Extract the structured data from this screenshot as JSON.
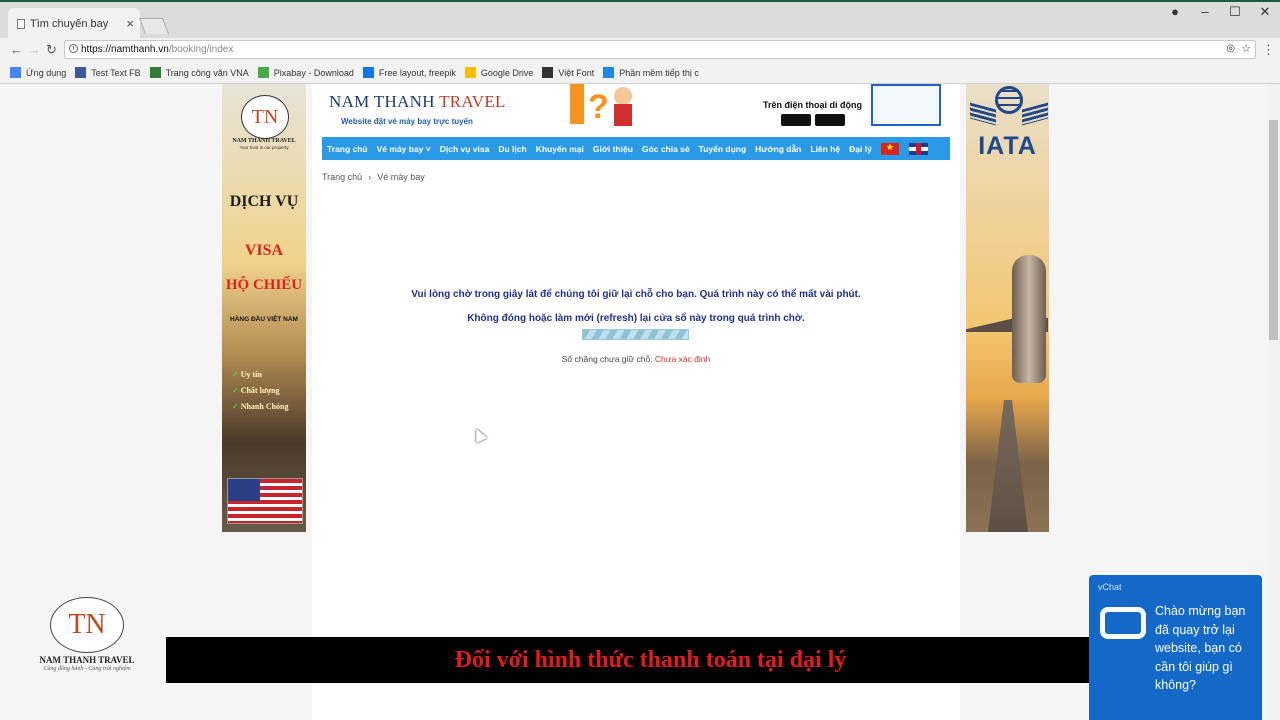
{
  "browser": {
    "tab_title": "Tìm chuyến bay",
    "url_host": "https://namthanh.vn",
    "url_path": "/booking/index",
    "bookmarks": [
      {
        "label": "Ứng dụng",
        "icon": "apps-icon",
        "color": "#4285f4"
      },
      {
        "label": "Test Text FB",
        "icon": "facebook-icon",
        "color": "#3b5998"
      },
      {
        "label": "Trang công văn VNA",
        "icon": "doc-icon",
        "color": "#2e7d32"
      },
      {
        "label": "Pixabay - Download",
        "icon": "pixabay-icon",
        "color": "#48a947"
      },
      {
        "label": "Free layout, freepik",
        "icon": "freepik-icon",
        "color": "#1273eb"
      },
      {
        "label": "Google Drive",
        "icon": "drive-icon",
        "color": "#fbbc04"
      },
      {
        "label": "Việt Font",
        "icon": "font-icon",
        "color": "#333333"
      },
      {
        "label": "Phần mềm tiếp thị c",
        "icon": "mail-icon",
        "color": "#1e88e5"
      }
    ]
  },
  "site": {
    "brand_a": "NAM THANH",
    "brand_b": "TRAVEL",
    "tagline": "Website đặt vé máy bay trực tuyến",
    "app_text": "Trên điện thoại di động",
    "nav": [
      "Trang chủ",
      "Vé máy bay ˅",
      "Dịch vụ visa",
      "Du lịch",
      "Khuyến mại",
      "Giới thiệu",
      "Góc chia sẻ",
      "Tuyển dụng",
      "Hướng dẫn",
      "Liên hệ",
      "Đại lý"
    ],
    "breadcrumb": [
      "Trang chủ",
      "›",
      "Vé máy bay"
    ]
  },
  "main": {
    "wait_message": "Vui lòng chờ trong giây lát để chúng tôi giữ lại chỗ cho bạn. Quá trình này có thể mất vài phút.",
    "warning_message": "Không đóng hoặc làm mới (refresh) lại cửa sổ này trong quá trình chờ.",
    "status_label": "Số chặng chưa giữ chỗ:",
    "status_value": "Chưa xác định"
  },
  "left_banner": {
    "logo_letters": "TN",
    "brand": "NAM THANH TRAVEL",
    "sub": "Your trust is our property",
    "line1": "DỊCH VỤ",
    "line2": "VISA",
    "line3": "HỘ CHIẾU",
    "line4": "HÀNG ĐẦU VIỆT NAM",
    "features": [
      "Uy tín",
      "Chất lượng",
      "Nhanh Chóng"
    ]
  },
  "right_banner": {
    "logo_text": "IATA"
  },
  "watermark": {
    "letters": "TN",
    "brand": "NAM THANH TRAVEL",
    "sub": "Cùng đồng hành - Cùng trải nghiệm"
  },
  "subtitle": "Đối với hình thức thanh toán tại đại lý",
  "chat": {
    "brand": "vChat",
    "message": "Chào mừng bạn đã quay trở lại website, bạn có cần tôi giúp gì không?"
  }
}
